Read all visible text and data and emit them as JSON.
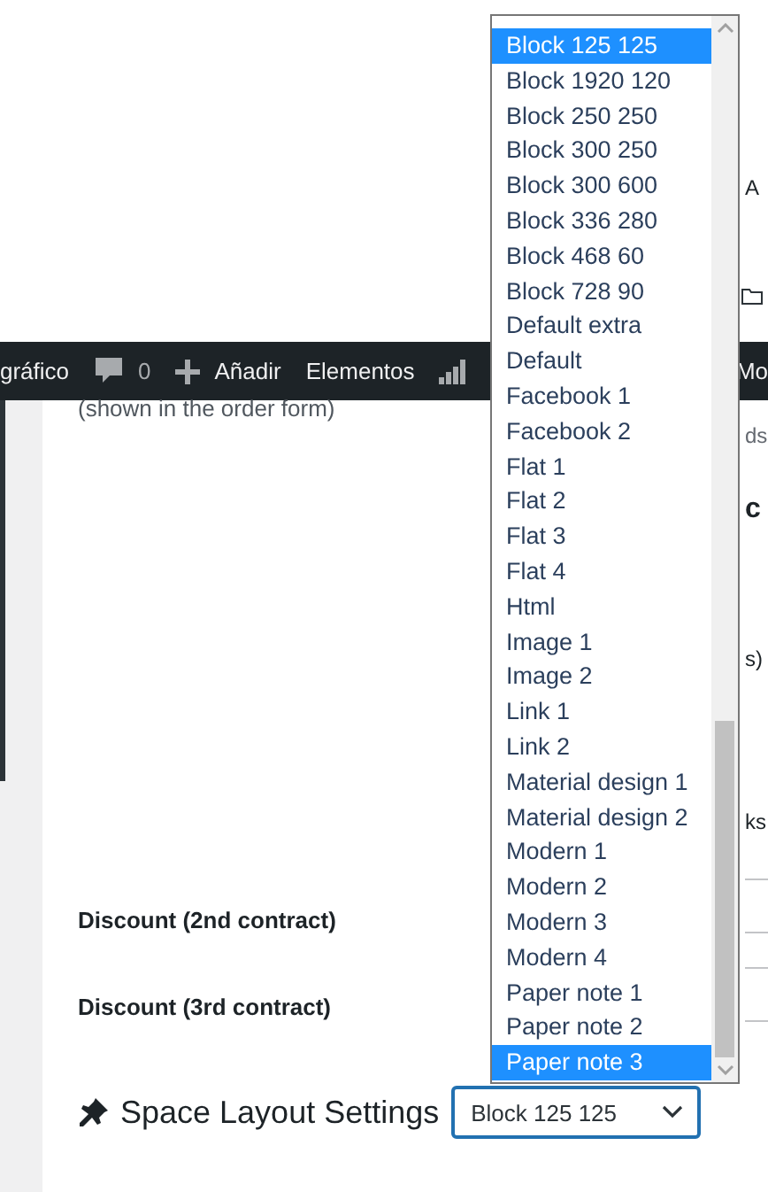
{
  "top_right": {
    "fragments": [
      {
        "kind": "text",
        "text": "A"
      },
      {
        "kind": "folder"
      }
    ]
  },
  "admin_bar": {
    "items": [
      {
        "kind": "text",
        "label": "gráfico"
      },
      {
        "kind": "comments",
        "label": "0"
      },
      {
        "kind": "add",
        "label": "Añadir"
      },
      {
        "kind": "text",
        "label": "Elementos"
      },
      {
        "kind": "chart"
      },
      {
        "kind": "end",
        "label": "Mo"
      }
    ]
  },
  "form": {
    "note": "(shown in the order form)",
    "fields": [
      {
        "label": "Discount (2nd contract)"
      },
      {
        "label": "Discount (3rd contract)"
      }
    ],
    "section_title": "Space Layout Settings"
  },
  "right_column": {
    "fragments": [
      {
        "kind": "muted",
        "text": "ds"
      },
      {
        "kind": "heading",
        "text": "c"
      },
      {
        "kind": "text",
        "text": "s)"
      },
      {
        "kind": "text",
        "text": "ks"
      }
    ]
  },
  "select": {
    "value": "Block 125 125",
    "expanded": true,
    "options": [
      {
        "label": "Block 125 125",
        "selected": true
      },
      {
        "label": "Block 1920 120",
        "selected": false
      },
      {
        "label": "Block 250 250",
        "selected": false
      },
      {
        "label": "Block 300 250",
        "selected": false
      },
      {
        "label": "Block 300 600",
        "selected": false
      },
      {
        "label": "Block 336 280",
        "selected": false
      },
      {
        "label": "Block 468 60",
        "selected": false
      },
      {
        "label": "Block 728 90",
        "selected": false
      },
      {
        "label": "Default extra",
        "selected": false
      },
      {
        "label": "Default",
        "selected": false
      },
      {
        "label": "Facebook 1",
        "selected": false
      },
      {
        "label": "Facebook 2",
        "selected": false
      },
      {
        "label": "Flat 1",
        "selected": false
      },
      {
        "label": "Flat 2",
        "selected": false
      },
      {
        "label": "Flat 3",
        "selected": false
      },
      {
        "label": "Flat 4",
        "selected": false
      },
      {
        "label": "Html",
        "selected": false
      },
      {
        "label": "Image 1",
        "selected": false
      },
      {
        "label": "Image 2",
        "selected": false
      },
      {
        "label": "Link 1",
        "selected": false
      },
      {
        "label": "Link 2",
        "selected": false
      },
      {
        "label": "Material design 1",
        "selected": false
      },
      {
        "label": "Material design 2",
        "selected": false
      },
      {
        "label": "Modern 1",
        "selected": false
      },
      {
        "label": "Modern 2",
        "selected": false
      },
      {
        "label": "Modern 3",
        "selected": false
      },
      {
        "label": "Modern 4",
        "selected": false
      },
      {
        "label": "Paper note 1",
        "selected": false
      },
      {
        "label": "Paper note 2",
        "selected": false
      },
      {
        "label": "Paper note 3",
        "selected": true
      }
    ]
  }
}
